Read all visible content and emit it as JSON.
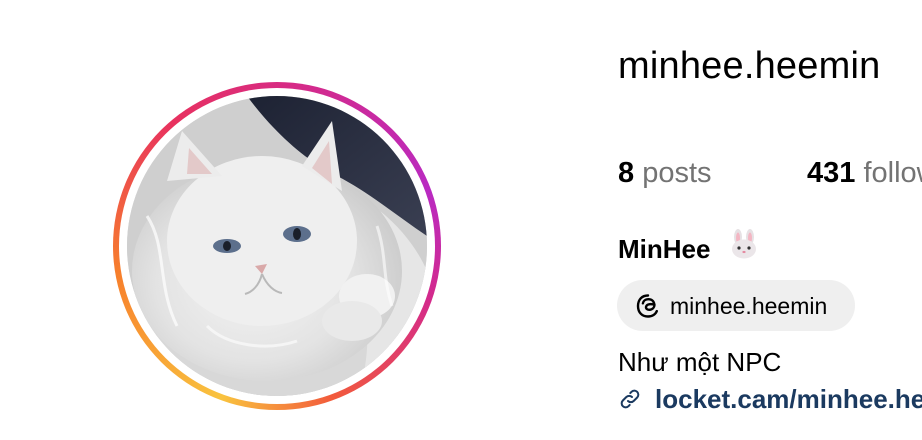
{
  "profile": {
    "username": "minhee.heemin",
    "display_name": "MinHee",
    "display_name_emoji": "rabbit-face-icon",
    "avatar": "profile-photo-white-cat",
    "story_ring_colors": [
      "#f9c33f",
      "#f77f2c",
      "#e8315f",
      "#d42a8a",
      "#b92ac2"
    ]
  },
  "stats": {
    "posts": {
      "count": "8",
      "label": "posts"
    },
    "followers": {
      "count": "431",
      "label": "followers"
    }
  },
  "threads": {
    "icon": "threads-icon",
    "handle": "minhee.heemin"
  },
  "bio": {
    "text": "Như một NPC",
    "link_icon": "link-icon",
    "link": "locket.cam/minhee.heemin",
    "link_color": "#1b3a60"
  }
}
